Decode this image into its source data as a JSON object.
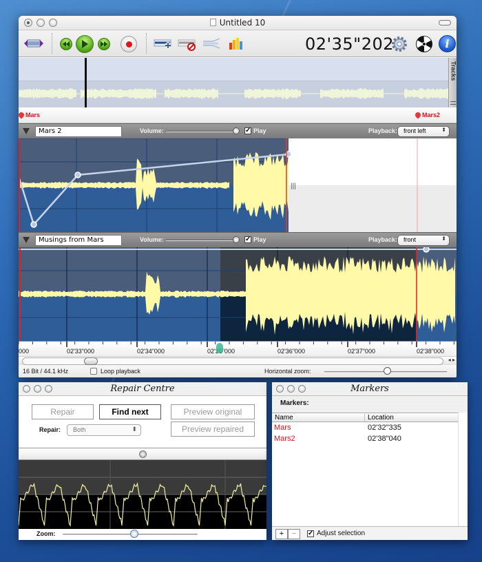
{
  "main_window": {
    "title": "Untitled 10",
    "time_display": "02'35\"202",
    "toolbar": {
      "icons": [
        "fit-tracks-icon",
        "rewind-icon",
        "play-icon",
        "fast-forward-icon",
        "record-icon",
        "add-track-icon",
        "remove-track-icon",
        "crossfade-icon",
        "levels-icon",
        "settings-gear-icon",
        "burn-icon",
        "info-icon"
      ]
    },
    "overview": {
      "tracks_tab_label": "Tracks"
    },
    "markers_bar": [
      {
        "label": "Mars",
        "color": "#e0101a"
      },
      {
        "label": "Mars2",
        "color": "#e0101a"
      }
    ],
    "tracks": [
      {
        "name": "Mars 2",
        "volume_label": "Volume:",
        "volume": 1.0,
        "play_label": "Play",
        "play_checked": true,
        "playback_label": "Playback:",
        "playback": "front left"
      },
      {
        "name": "Musings from Mars",
        "volume_label": "Volume:",
        "volume": 1.0,
        "play_label": "Play",
        "play_checked": true,
        "playback_label": "Playback:",
        "playback": "front"
      }
    ],
    "ruler": {
      "ticks": [
        "000",
        "02'33\"000",
        "02'34\"000",
        "02'35\"000",
        "02'36\"000",
        "02'37\"000",
        "02'38\"000"
      ]
    },
    "status": {
      "format": "16 Bit / 44.1 kHz",
      "loop_label": "Loop playback",
      "loop_checked": false,
      "hzoom_label": "Horizontal zoom:"
    }
  },
  "repair_window": {
    "title": "Repair Centre",
    "buttons": {
      "repair": "Repair",
      "find_next": "Find next",
      "preview_original": "Preview original",
      "preview_repaired": "Preview repaired"
    },
    "repair_label": "Repair:",
    "repair_option": "Both",
    "zoom_label": "Zoom:"
  },
  "markers_window": {
    "title": "Markers",
    "heading": "Markers:",
    "columns": [
      "Name",
      "Location"
    ],
    "rows": [
      {
        "name": "Mars",
        "location": "02'32\"335"
      },
      {
        "name": "Mars2",
        "location": "02'38\"040"
      }
    ],
    "add_label": "+",
    "remove_label": "−",
    "adjust_label": "Adjust selection",
    "adjust_checked": true,
    "marker_color": "#e0101a"
  }
}
